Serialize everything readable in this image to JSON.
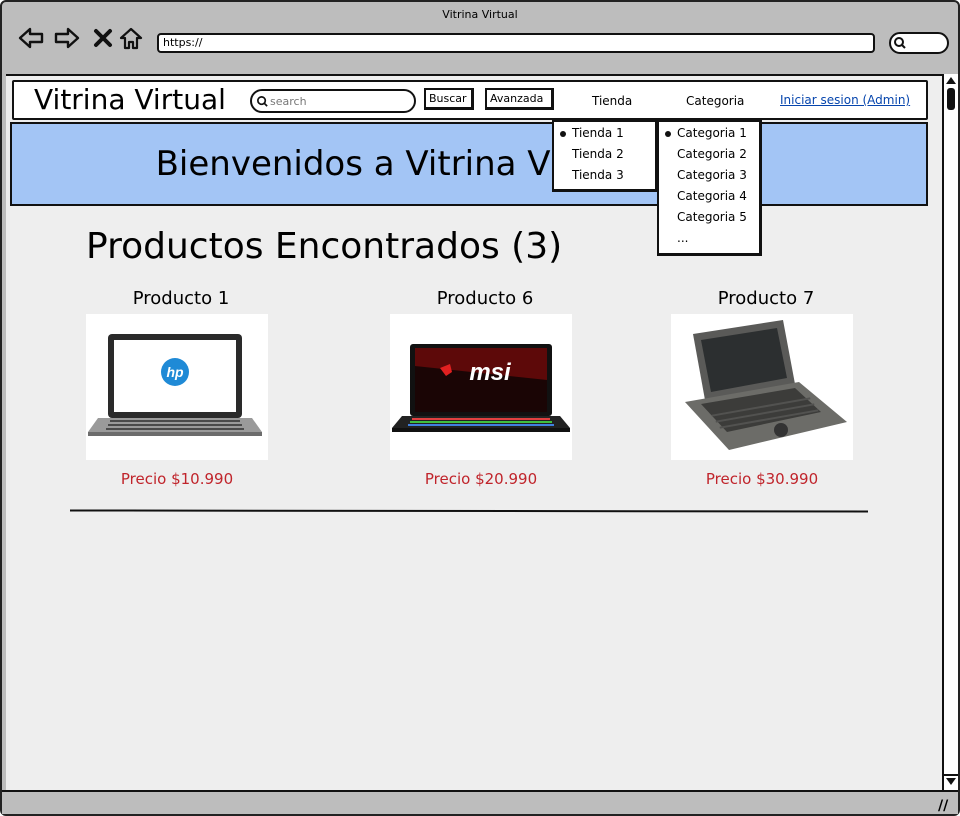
{
  "browser": {
    "window_title": "Vitrina Virtual",
    "url": "https://",
    "nav_icons": [
      "back-arrow-icon",
      "forward-arrow-icon",
      "stop-x-icon",
      "home-icon"
    ],
    "search_icon": "search-icon"
  },
  "header": {
    "logo": "Vitrina Virtual",
    "search_placeholder": "search",
    "buscar_label": "Buscar",
    "avanzada_label": "Avanzada",
    "tienda_label": "Tienda",
    "categoria_label": "Categoria",
    "login_label": "Iniciar sesion (Admin)"
  },
  "banner": {
    "text": "Bienvenidos a Vitrina Virtual"
  },
  "dropdown_tienda": {
    "items": [
      "Tienda 1",
      "Tienda 2",
      "Tienda 3"
    ],
    "selected_index": 0
  },
  "dropdown_categoria": {
    "items": [
      "Categoria 1",
      "Categoria 2",
      "Categoria 3",
      "Categoria 4",
      "Categoria 5",
      "..."
    ],
    "selected_index": 0
  },
  "results": {
    "title": "Productos Encontrados (3)"
  },
  "products": [
    {
      "name": "Producto 1",
      "price": "Precio $10.990",
      "image": "hp-laptop-image",
      "image_text": "hp"
    },
    {
      "name": "Producto 6",
      "price": "Precio $20.990",
      "image": "msi-laptop-image",
      "image_text": "msi"
    },
    {
      "name": "Producto 7",
      "price": "Precio $30.990",
      "image": "vintage-laptop-image",
      "image_text": ""
    }
  ],
  "colors": {
    "banner_bg": "#a3c5f5",
    "price_color": "#c0242b",
    "link_color": "#0645ad",
    "page_bg": "#eeeeee",
    "chrome_bg": "#bdbdbd"
  }
}
